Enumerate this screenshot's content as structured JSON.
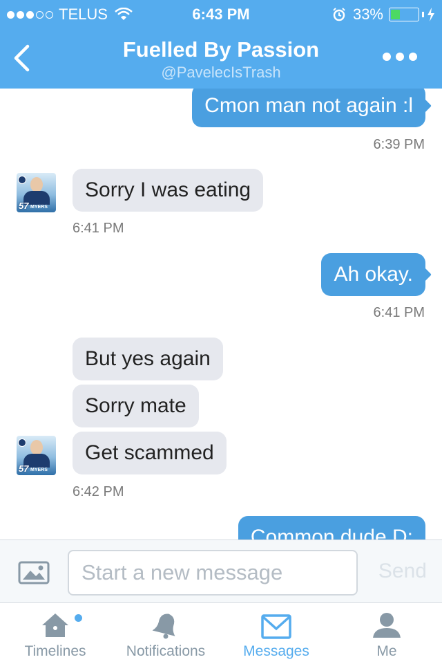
{
  "status_bar": {
    "carrier": "TELUS",
    "signal_bars_filled": 3,
    "signal_bars_total": 5,
    "time": "6:43 PM",
    "battery_percent": "33%",
    "battery_level": 0.33,
    "battery_color": "#4cd964"
  },
  "header": {
    "title": "Fuelled By Passion",
    "subtitle": "@PavelecIsTrash",
    "back_icon": "chevron-left-icon",
    "more_icon": "more-dots-icon",
    "color": "#55acee"
  },
  "messages": [
    {
      "direction": "outgoing",
      "text": "Cmon man not again :l",
      "time": "6:39 PM"
    },
    {
      "direction": "incoming",
      "text": "Sorry I was eating",
      "time": "6:41 PM"
    },
    {
      "direction": "outgoing",
      "text": "Ah okay.",
      "time": "6:41 PM"
    },
    {
      "direction": "incoming",
      "text": "But yes again"
    },
    {
      "direction": "incoming",
      "text": "Sorry mate"
    },
    {
      "direction": "incoming",
      "text": "Get scammed",
      "time": "6:42 PM"
    },
    {
      "direction": "outgoing",
      "text": "Common dude D:"
    }
  ],
  "avatar": {
    "number": "57",
    "name": "MYERS"
  },
  "composer": {
    "placeholder": "Start a new message",
    "value": "",
    "send_label": "Send",
    "photo_icon": "photo-icon"
  },
  "tabs": [
    {
      "label": "Timelines",
      "icon": "home-icon",
      "active": false,
      "has_new": true
    },
    {
      "label": "Notifications",
      "icon": "bell-icon",
      "active": false
    },
    {
      "label": "Messages",
      "icon": "envelope-icon",
      "active": true
    },
    {
      "label": "Me",
      "icon": "person-icon",
      "active": false
    }
  ],
  "colors": {
    "outgoing_bubble": "#4a9fe0",
    "incoming_bubble": "#e6e8ee",
    "active_tab": "#55acee",
    "inactive_tab": "#8899a6"
  }
}
